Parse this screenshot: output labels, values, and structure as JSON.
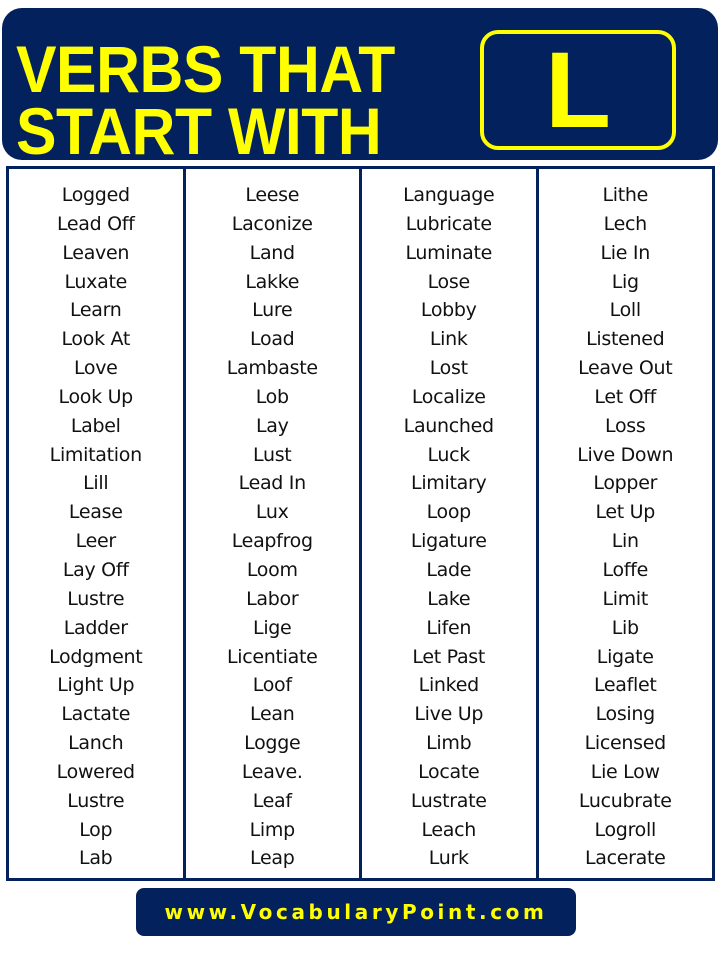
{
  "header": {
    "title_line1": "VERBS THAT",
    "title_line2": "START WITH",
    "letter": "L",
    "colors": {
      "background": "#03215d",
      "text": "#ffff00"
    }
  },
  "columns": [
    [
      "Logged",
      "Lead Off",
      "Leaven",
      "Luxate",
      "Learn",
      "Look At",
      "Love",
      "Look Up",
      "Label",
      "Limitation",
      "Lill",
      "Lease",
      "Leer",
      "Lay Off",
      "Lustre",
      "Ladder",
      "Lodgment",
      "Light Up",
      "Lactate",
      "Lanch",
      "Lowered",
      "Lustre",
      "Lop",
      "Lab"
    ],
    [
      "Leese",
      "Laconize",
      "Land",
      "Lakke",
      "Lure",
      "Load",
      "Lambaste",
      "Lob",
      "Lay",
      "Lust",
      "Lead In",
      "Lux",
      "Leapfrog",
      "Loom",
      "Labor",
      "Lige",
      "Licentiate",
      "Loof",
      "Lean",
      "Logge",
      "Leave.",
      "Leaf",
      "Limp",
      "Leap"
    ],
    [
      "Language",
      "Lubricate",
      "Luminate",
      "Lose",
      "Lobby",
      "Link",
      "Lost",
      "Localize",
      "Launched",
      "Luck",
      "Limitary",
      "Loop",
      "Ligature",
      "Lade",
      "Lake",
      "Lifen",
      "Let Past",
      "Linked",
      "Live Up",
      "Limb",
      "Locate",
      "Lustrate",
      "Leach",
      "Lurk"
    ],
    [
      "Lithe",
      "Lech",
      "Lie In",
      "Lig",
      "Loll",
      "Listened",
      "Leave Out",
      "Let Off",
      "Loss",
      "Live Down",
      "Lopper",
      "Let Up",
      "Lin",
      "Loffe",
      "Limit",
      "Lib",
      "Ligate",
      "Leaflet",
      "Losing",
      "Licensed",
      "Lie Low",
      "Lucubrate",
      "Logroll",
      "Lacerate"
    ]
  ],
  "footer": {
    "website": "www.VocabularyPoint.com"
  }
}
